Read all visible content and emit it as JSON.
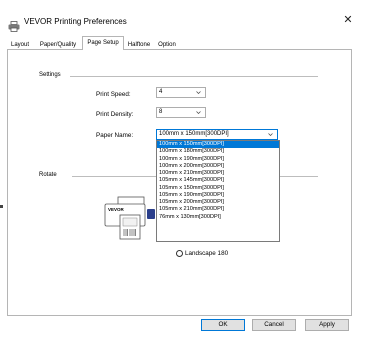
{
  "window": {
    "title": "VEVOR Printing Preferences",
    "close_glyph": "✕"
  },
  "tabs": [
    {
      "label": "Layout",
      "active": false
    },
    {
      "label": "Paper/Quality",
      "active": false
    },
    {
      "label": "Page Setup",
      "active": true
    },
    {
      "label": "Halftone",
      "active": false
    },
    {
      "label": "Option",
      "active": false
    }
  ],
  "settings": {
    "group_label": "Settings",
    "print_speed": {
      "label": "Print Speed:",
      "value": "4"
    },
    "print_density": {
      "label": "Print Density:",
      "value": "8"
    },
    "paper_name": {
      "label": "Paper Name:",
      "value": "100mm x 150mm[300DPI]",
      "options": [
        "100mm x 150mm[300DPI]",
        "100mm x 180mm[300DPI]",
        "100mm x 190mm[300DPI]",
        "100mm x 200mm[300DPI]",
        "100mm x 210mm[300DPI]",
        "105mm x 145mm[300DPI]",
        "105mm x 150mm[300DPI]",
        "105mm x 190mm[300DPI]",
        "105mm x 200mm[300DPI]",
        "105mm x 210mm[300DPI]",
        "76mm x 130mm[300DPI]"
      ],
      "selected_index": 0
    }
  },
  "rotate": {
    "group_label": "Rotate",
    "preview_brand": "VEVOR",
    "landscape180_label": "Landscape 180"
  },
  "buttons": {
    "ok": "OK",
    "cancel": "Cancel",
    "apply": "Apply"
  },
  "colors": {
    "selection": "#0078d7",
    "dialog_bg": "#ffffff",
    "button_bg": "#e1e1e1"
  }
}
